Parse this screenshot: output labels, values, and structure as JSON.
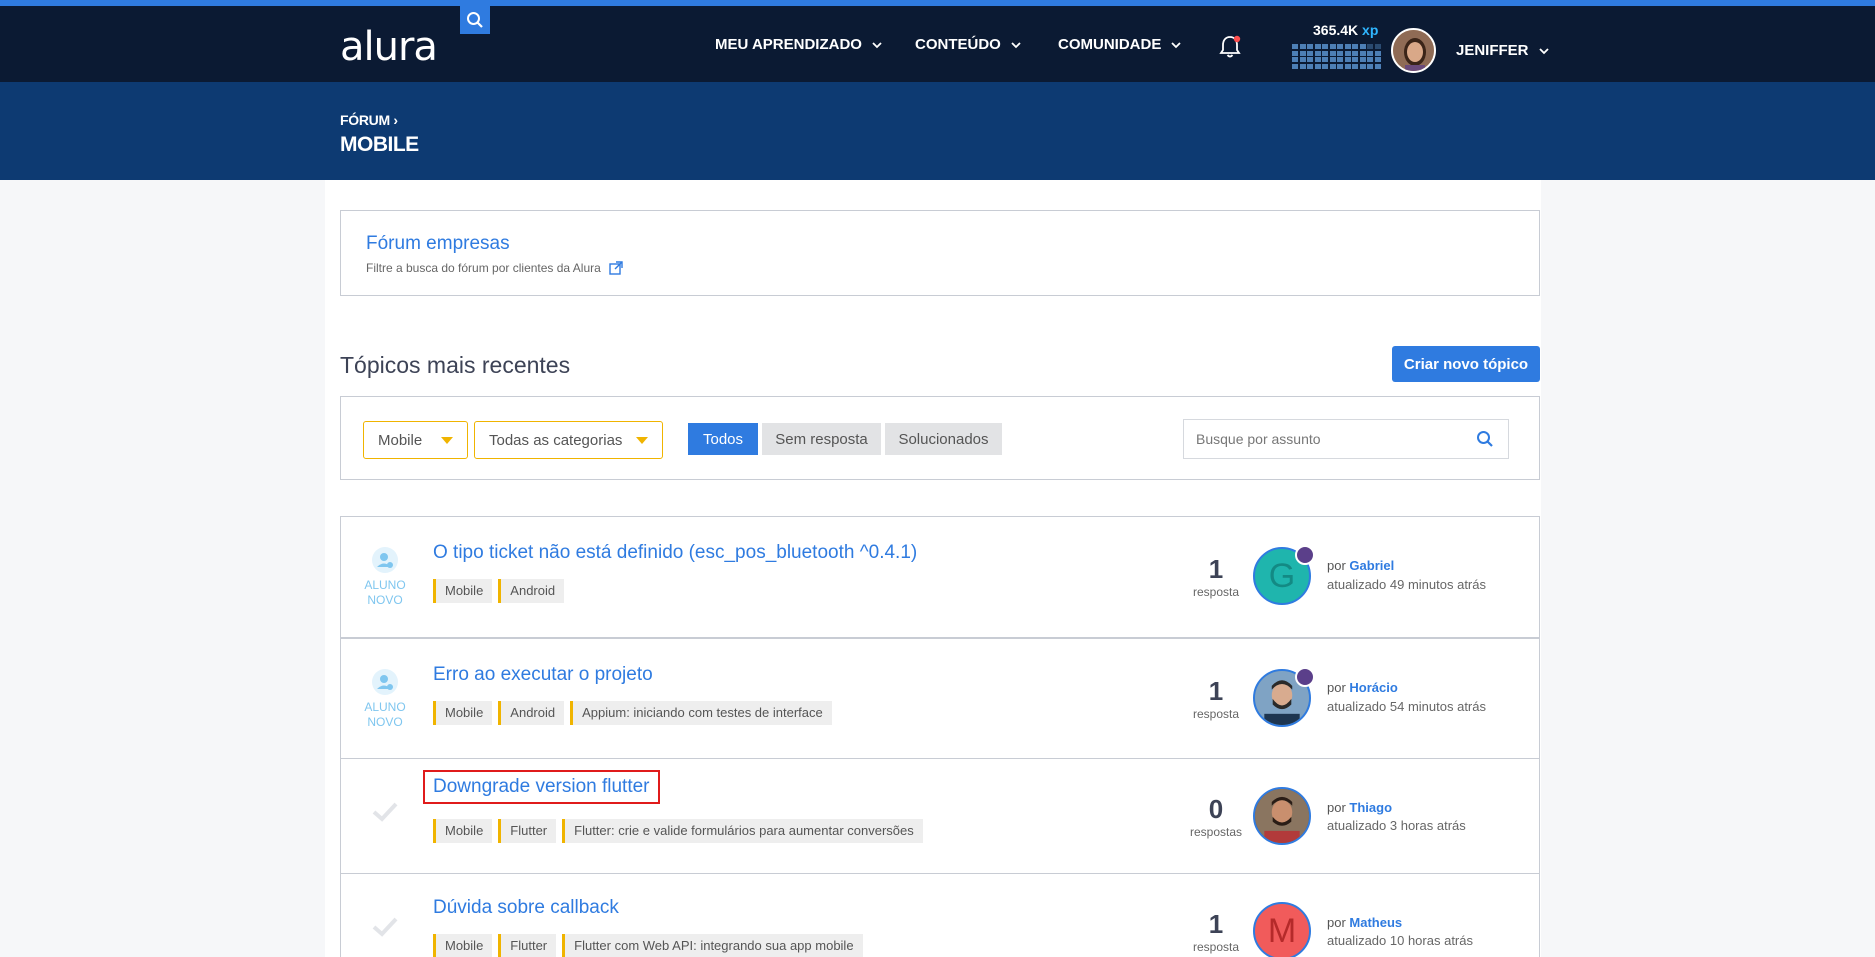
{
  "nav": {
    "logo": "alura",
    "items": [
      {
        "label": "MEU APRENDIZADO"
      },
      {
        "label": "CONTEÚDO"
      },
      {
        "label": "COMUNIDADE"
      }
    ],
    "xp_value": "365.4K",
    "xp_unit": "xp",
    "username": "JENIFFER",
    "colors": {
      "accent": "#2f7be0",
      "nav_bg": "#0b1a33",
      "band_bg": "#0d3a72",
      "tag_border": "#f0b400",
      "highlight": "#e01b1b"
    }
  },
  "header": {
    "breadcrumb": "FÓRUM",
    "title": "MOBILE"
  },
  "empresas": {
    "title": "Fórum empresas",
    "subtitle": "Filtre a busca do fórum por clientes da Alura"
  },
  "topics_section": {
    "title": "Tópicos mais recentes",
    "new_topic_button": "Criar novo tópico"
  },
  "filters": {
    "forum_select": "Mobile",
    "category_select": "Todas as categorias",
    "segments": [
      {
        "label": "Todos",
        "active": true
      },
      {
        "label": "Sem resposta",
        "active": false
      },
      {
        "label": "Solucionados",
        "active": false
      }
    ],
    "search_placeholder": "Busque por assunto"
  },
  "topics": [
    {
      "status_label_1": "ALUNO",
      "status_label_2": "NOVO",
      "title": "O tipo ticket não está definido (esc_pos_bluetooth ^0.4.1)",
      "tags": [
        "Mobile",
        "Android"
      ],
      "count": "1",
      "count_label": "resposta",
      "avatar_letter": "G",
      "by_prefix": "por",
      "author": "Gabriel",
      "updated": "atualizado 49 minutos atrás"
    },
    {
      "status_label_1": "ALUNO",
      "status_label_2": "NOVO",
      "title": "Erro ao executar o projeto",
      "tags": [
        "Mobile",
        "Android",
        "Appium: iniciando com testes de interface"
      ],
      "count": "1",
      "count_label": "resposta",
      "avatar_letter": "",
      "by_prefix": "por",
      "author": "Horácio",
      "updated": "atualizado 54 minutos atrás"
    },
    {
      "title": "Downgrade version flutter",
      "tags": [
        "Mobile",
        "Flutter",
        "Flutter: crie e valide formulários para aumentar conversões"
      ],
      "count": "0",
      "count_label": "respostas",
      "avatar_letter": "",
      "by_prefix": "por",
      "author": "Thiago",
      "updated": "atualizado 3 horas atrás"
    },
    {
      "title": "Dúvida sobre callback",
      "tags": [
        "Mobile",
        "Flutter",
        "Flutter com Web API: integrando sua app mobile"
      ],
      "count": "1",
      "count_label": "resposta",
      "avatar_letter": "M",
      "by_prefix": "por",
      "author": "Matheus",
      "updated": "atualizado 10 horas atrás"
    }
  ]
}
